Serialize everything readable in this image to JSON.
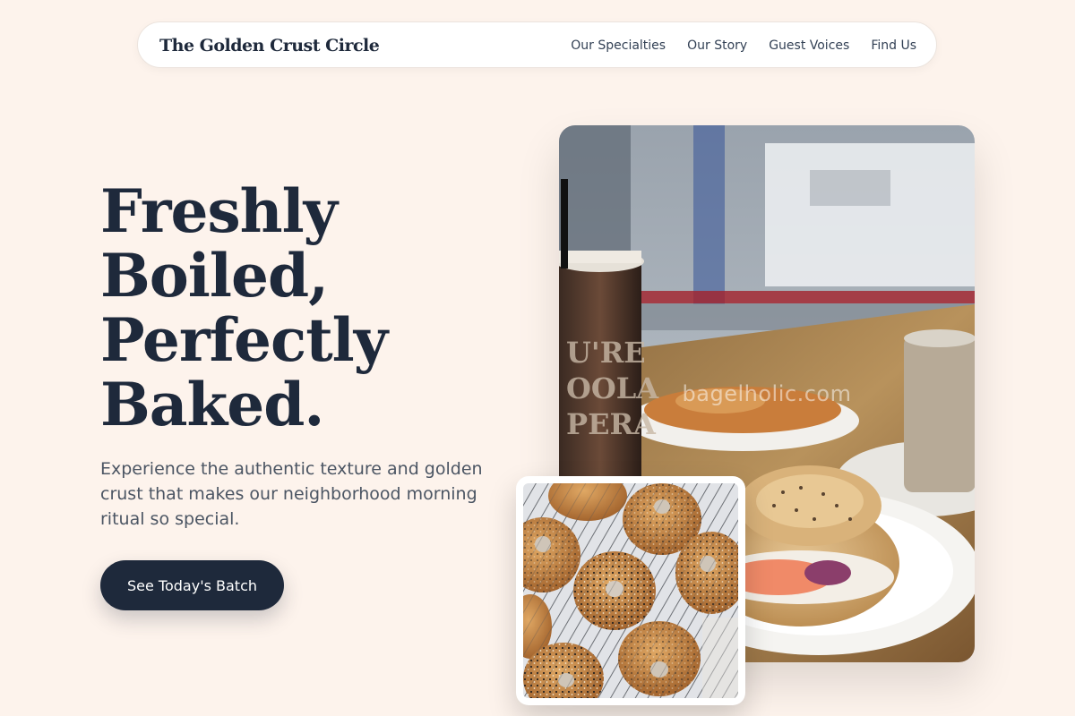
{
  "nav": {
    "brand": "The Golden Crust Circle",
    "links": [
      "Our Specialties",
      "Our Story",
      "Guest Voices",
      "Find Us"
    ]
  },
  "hero": {
    "title_lines": [
      "Freshly",
      "Boiled,",
      "Perfectly",
      "Baked."
    ],
    "subtitle": "Experience the authentic texture and golden crust that makes our neighborhood morning ritual so special.",
    "cta_label": "See Today's Batch"
  },
  "photos": {
    "main_watermark": "bagelholic.com"
  },
  "colors": {
    "background": "#fdf3ec",
    "accent_dark": "#1e293b",
    "text_muted": "#4b5563"
  }
}
